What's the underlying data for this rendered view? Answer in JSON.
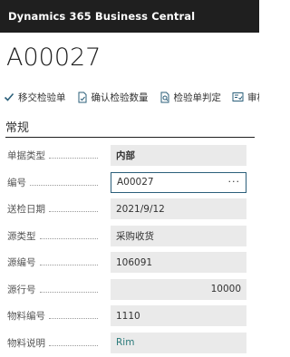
{
  "app": {
    "title": "Dynamics 365 Business Central"
  },
  "page": {
    "title": "A00027"
  },
  "toolbar": {
    "actions": [
      {
        "label": "移交检验单",
        "icon": "checkmark-icon"
      },
      {
        "label": "确认检验数量",
        "icon": "document-confirm-icon"
      },
      {
        "label": "检验单判定",
        "icon": "document-search-icon"
      },
      {
        "label": "审核",
        "icon": "approve-icon"
      }
    ]
  },
  "section": {
    "title": "常规"
  },
  "fields": [
    {
      "label": "单据类型",
      "value": "内部"
    },
    {
      "label": "编号",
      "value": "A00027",
      "action": "···"
    },
    {
      "label": "送检日期",
      "value": "2021/9/12"
    },
    {
      "label": "源类型",
      "value": "采购收货"
    },
    {
      "label": "源编号",
      "value": "106091"
    },
    {
      "label": "源行号",
      "value": "10000"
    },
    {
      "label": "物料编号",
      "value": "1110"
    },
    {
      "label": "物料说明",
      "value": "Rim"
    }
  ],
  "colors": {
    "topbar": "#1f1f1f",
    "accent": "#2b5f7a",
    "link": "#2b7a7a",
    "field_bg": "#eaeaea"
  }
}
